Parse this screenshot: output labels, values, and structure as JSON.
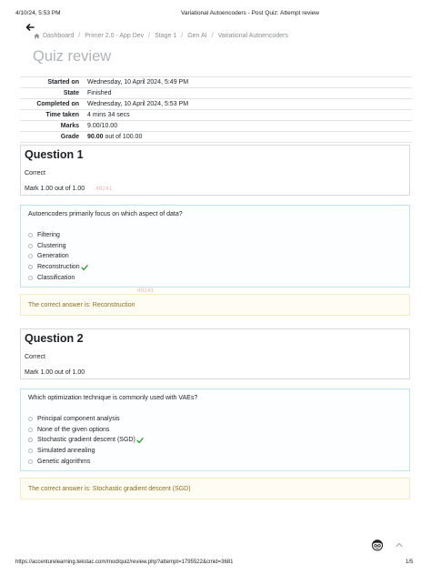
{
  "print": {
    "datetime": "4/10/24, 5:53 PM",
    "doc_title": "Variational Autoencoders - Post Quiz: Attempt review",
    "url": "https://accenturelearning.tekstac.com/mod/quiz/review.php?attempt=1795522&cmid=3681",
    "page": "1/5"
  },
  "breadcrumb": [
    "Dashboard",
    "Primer 2.0 - App Dev",
    "Stage 1",
    "Gen AI",
    "Variational Autoencoders"
  ],
  "page_title": "Quiz review",
  "summary": [
    {
      "label": "Started on",
      "value": "Wednesday, 10 April 2024, 5:49 PM"
    },
    {
      "label": "State",
      "value": "Finished"
    },
    {
      "label": "Completed on",
      "value": "Wednesday, 10 April 2024, 5:53 PM"
    },
    {
      "label": "Time taken",
      "value": "4 mins 34 secs"
    },
    {
      "label": "Marks",
      "value": "9.00/10.00"
    },
    {
      "label": "Grade",
      "value_bold": "90.00",
      "value_rest": " out of 100.00"
    }
  ],
  "watermark": "49241",
  "questions": [
    {
      "title": "Question 1",
      "state": "Correct",
      "mark": "Mark 1.00 out of 1.00",
      "text": "Autoencoders primarily focus on which aspect of data?",
      "options": [
        "Filtering",
        "Clustering",
        "Generation",
        "Reconstruction",
        "Classification"
      ],
      "selected_index": 3,
      "feedback": "The correct answer is: Reconstruction"
    },
    {
      "title": "Question 2",
      "state": "Correct",
      "mark": "Mark 1.00 out of 1.00",
      "text": "Which optimization technique is commonly used with VAEs?",
      "options": [
        "Principal component analysis",
        "None of the given options",
        "Stochastic gradient descent (SGD)",
        "Simulated annealing",
        "Genetic algorithms"
      ],
      "selected_index": 2,
      "feedback": "The correct answer is: Stochastic gradient descent (SGD)"
    }
  ],
  "icons": {
    "back": "arrow-left-icon",
    "home": "home-icon",
    "correct": "check-icon",
    "avatar": "avatar-icon",
    "scroll_top": "chevron-up-icon"
  },
  "colors": {
    "correct_check": "#3a9a3a",
    "feedback_text": "#8a6d1f",
    "feedback_bg": "#fffdf3",
    "formulation_border": "#bfe3ee",
    "watermark": "#f0b8b8"
  }
}
